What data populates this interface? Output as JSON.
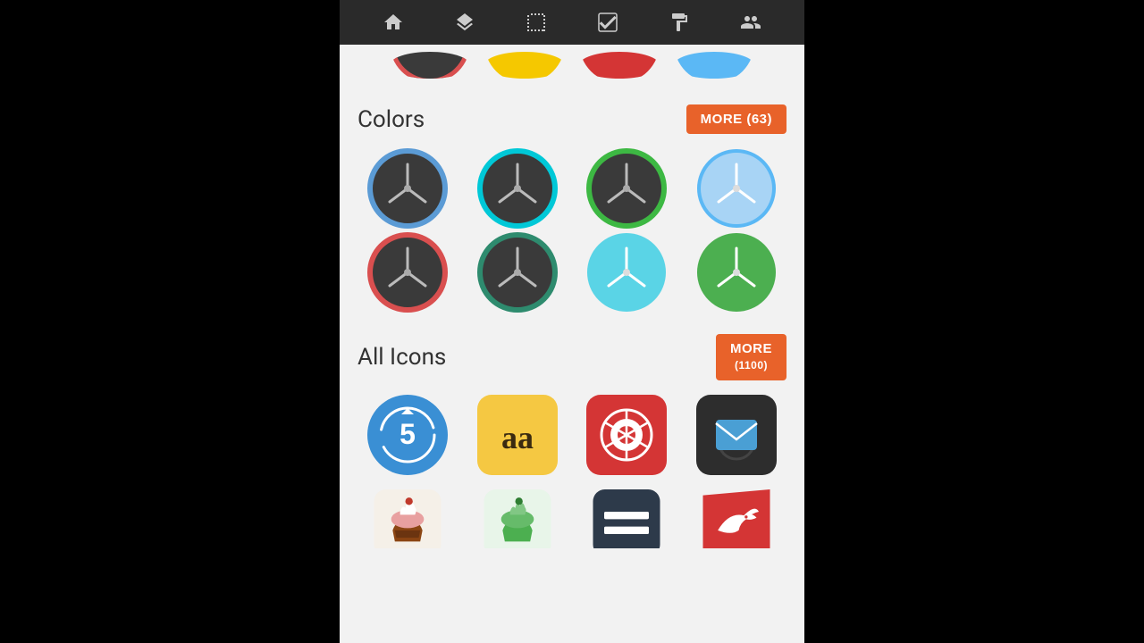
{
  "nav": {
    "icons": [
      {
        "name": "home",
        "label": "Home"
      },
      {
        "name": "layers",
        "label": "Layers"
      },
      {
        "name": "selection",
        "label": "Selection"
      },
      {
        "name": "check",
        "label": "Check"
      },
      {
        "name": "paint",
        "label": "Paint"
      },
      {
        "name": "people",
        "label": "People"
      }
    ]
  },
  "sections": {
    "colors": {
      "title": "Colors",
      "more_btn": "MORE (63)",
      "clocks": [
        {
          "border": "#5b9bd5",
          "bg": "#3a3a3a",
          "fill": "dark"
        },
        {
          "border": "#00c8d7",
          "bg": "#3a3a3a",
          "fill": "dark"
        },
        {
          "border": "#3db843",
          "bg": "#3a3a3a",
          "fill": "dark"
        },
        {
          "border": "#5bb8f5",
          "bg": "#a8d4f5",
          "fill": "light"
        },
        {
          "border": "#d94f4f",
          "bg": "#3a3a3a",
          "fill": "dark"
        },
        {
          "border": "#2e8b6e",
          "bg": "#3a3a3a",
          "fill": "dark"
        },
        {
          "border": "#5ad4e6",
          "bg": "#5ad4e6",
          "fill": "light"
        },
        {
          "border": "#4caf50",
          "bg": "#4caf50",
          "fill": "light"
        }
      ]
    },
    "all_icons": {
      "title": "All Icons",
      "more_btn": "MORE\n(1100)",
      "apps": [
        {
          "type": "circle",
          "bg": "#3a8fd4",
          "label": "5x"
        },
        {
          "type": "square",
          "bg": "#f5c842",
          "label": "aa"
        },
        {
          "type": "square",
          "bg": "#d43535",
          "label": "camera"
        },
        {
          "type": "square",
          "bg": "#3a3a3a",
          "label": "mail"
        }
      ],
      "bottom_apps": [
        {
          "type": "square",
          "bg": "#f5f0e8",
          "label": "cupcake"
        },
        {
          "type": "square",
          "bg": "#e8f5e9",
          "label": "android"
        },
        {
          "type": "square",
          "bg": "#2d3a4a",
          "label": "menu"
        },
        {
          "type": "square",
          "bg": "#d43535",
          "label": "bird"
        }
      ]
    }
  }
}
